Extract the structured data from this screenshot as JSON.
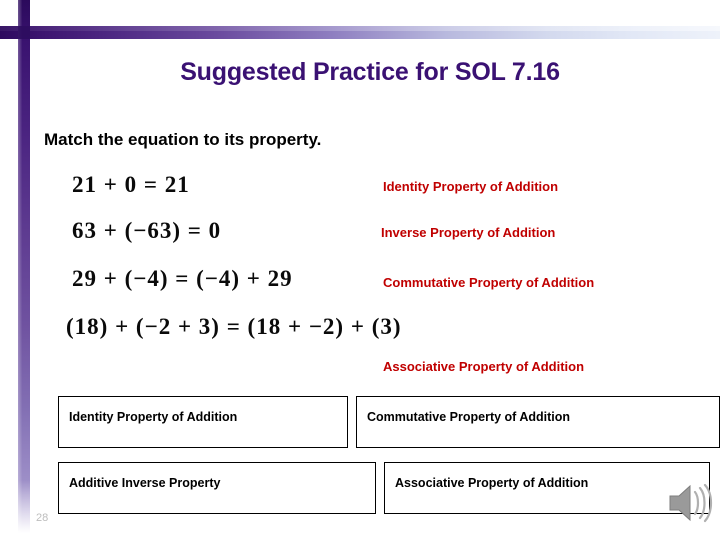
{
  "slide": {
    "title": "Suggested Practice for SOL 7.16",
    "prompt": "Match the equation to its property.",
    "page_number": "28",
    "title_color": "#3a1173",
    "label_color": "#c00000",
    "accent_color": "#2d0a5e"
  },
  "equations": [
    {
      "id": "equation-1",
      "text": "21 + 0 = 21"
    },
    {
      "id": "equation-2",
      "text": "63 + (−63) = 0"
    },
    {
      "id": "equation-3",
      "text": "29 + (−4) = (−4) + 29"
    },
    {
      "id": "equation-4",
      "text": "(18) + (−2 + 3) = (18 + −2) + (3)"
    }
  ],
  "property_labels": [
    {
      "id": "label-identity",
      "text": "Identity Property of Addition"
    },
    {
      "id": "label-inverse",
      "text": "Inverse Property of Addition"
    },
    {
      "id": "label-commutative",
      "text": "Commutative Property of Addition"
    },
    {
      "id": "label-associative",
      "text": "Associative Property of Addition"
    }
  ],
  "answer_boxes": [
    {
      "id": "answer-box-1",
      "text": "Identity Property of Addition"
    },
    {
      "id": "answer-box-2",
      "text": "Commutative Property of Addition"
    },
    {
      "id": "answer-box-3",
      "text": "Additive Inverse Property"
    },
    {
      "id": "answer-box-4",
      "text": "Associative Property of Addition"
    }
  ],
  "icons": {
    "speaker": "speaker-icon"
  }
}
